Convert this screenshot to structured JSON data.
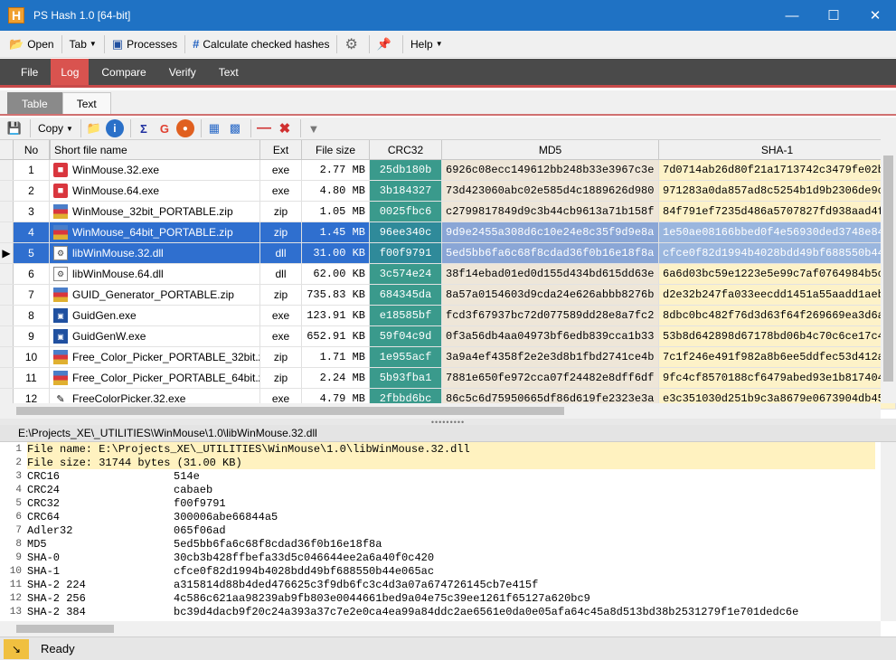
{
  "window": {
    "app_letter": "H",
    "title": "PS Hash 1.0   [64-bit]"
  },
  "toolbar": {
    "open": "Open",
    "tab": "Tab",
    "processes": "Processes",
    "calculate": "Calculate checked hashes",
    "help": "Help"
  },
  "main_tabs": [
    "File",
    "Log",
    "Compare",
    "Verify",
    "Text"
  ],
  "sub_tabs": [
    "Table",
    "Text"
  ],
  "toolbar2": {
    "copy": "Copy"
  },
  "grid": {
    "headers": [
      "No",
      "Short file name",
      "Ext",
      "File size",
      "CRC32",
      "MD5",
      "SHA-1"
    ],
    "rows": [
      {
        "no": "1",
        "name": "WinMouse.32.exe",
        "ext": "exe",
        "size": "2.77  MB",
        "crc32": "25db180b",
        "md5": "6926c08ecc149612bb248b33e3967c3e",
        "sha1": "7d0714ab26d80f21a1713742c3479fe02b"
      },
      {
        "no": "2",
        "name": "WinMouse.64.exe",
        "ext": "exe",
        "size": "4.80  MB",
        "crc32": "3b184327",
        "md5": "73d423060abc02e585d4c1889626d980",
        "sha1": "971283a0da857ad8c5254b1d9b2306de9c"
      },
      {
        "no": "3",
        "name": "WinMouse_32bit_PORTABLE.zip",
        "ext": "zip",
        "size": "1.05  MB",
        "crc32": "0025fbc6",
        "md5": "c2799817849d9c3b44cb9613a71b158f",
        "sha1": "84f791ef7235d486a5707827fd938aad4f"
      },
      {
        "no": "4",
        "name": "WinMouse_64bit_PORTABLE.zip",
        "ext": "zip",
        "size": "1.45  MB",
        "crc32": "96ee340c",
        "md5": "9d9e2455a308d6c10e24e8c35f9d9e8a",
        "sha1": "1e50ae08166bbed0f4e56930ded3748e84"
      },
      {
        "no": "5",
        "name": "libWinMouse.32.dll",
        "ext": "dll",
        "size": "31.00  KB",
        "crc32": "f00f9791",
        "md5": "5ed5bb6fa6c68f8cdad36f0b16e18f8a",
        "sha1": "cfce0f82d1994b4028bdd49bf688550b44"
      },
      {
        "no": "6",
        "name": "libWinMouse.64.dll",
        "ext": "dll",
        "size": "62.00  KB",
        "crc32": "3c574e24",
        "md5": "38f14ebad01ed0d155d434bd615dd63e",
        "sha1": "6a6d03bc59e1223e5e99c7af0764984b5c"
      },
      {
        "no": "7",
        "name": "GUID_Generator_PORTABLE.zip",
        "ext": "zip",
        "size": "735.83  KB",
        "crc32": "684345da",
        "md5": "8a57a0154603d9cda24e626abbb8276b",
        "sha1": "d2e32b247fa033eecdd1451a55aadd1aeb"
      },
      {
        "no": "8",
        "name": "GuidGen.exe",
        "ext": "exe",
        "size": "123.91  KB",
        "crc32": "e18585bf",
        "md5": "fcd3f67937bc72d077589dd28e8a7fc2",
        "sha1": "8dbc0bc482f76d3d63f64f269669ea3d6a"
      },
      {
        "no": "9",
        "name": "GuidGenW.exe",
        "ext": "exe",
        "size": "652.91  KB",
        "crc32": "59f04c9d",
        "md5": "0f3a56db4aa04973bf6edb839cca1b33",
        "sha1": "53b8d642898d67178bd06b4c70c6ce17c4"
      },
      {
        "no": "10",
        "name": "Free_Color_Picker_PORTABLE_32bit.zip",
        "ext": "zip",
        "size": "1.71  MB",
        "crc32": "1e955acf",
        "md5": "3a9a4ef4358f2e2e3d8b1fbd2741ce4b",
        "sha1": "7c1f246e491f982a8b6ee5ddfec53d412a"
      },
      {
        "no": "11",
        "name": "Free_Color_Picker_PORTABLE_64bit.zip",
        "ext": "zip",
        "size": "2.24  MB",
        "crc32": "5b93fba1",
        "md5": "7881e650fe972cca07f24482e8dff6df",
        "sha1": "9fc4cf8570188cf6479abed93e1b817404"
      },
      {
        "no": "12",
        "name": "FreeColorPicker.32.exe",
        "ext": "exe",
        "size": "4.79  MB",
        "crc32": "2fbbd6bc",
        "md5": "86c5c6d75950665df86d619fe2323e3a",
        "sha1": "e3c351030d251b9c3a8679e0673904db45"
      }
    ]
  },
  "path": "E:\\Projects_XE\\_UTILITIES\\WinMouse\\1.0\\libWinMouse.32.dll",
  "log": [
    {
      "n": "1",
      "k": "File name: ",
      "v": "E:\\Projects_XE\\_UTILITIES\\WinMouse\\1.0\\libWinMouse.32.dll"
    },
    {
      "n": "2",
      "k": "File size: ",
      "v": "31744 bytes (31.00 KB)"
    },
    {
      "n": "3",
      "k": "CRC16",
      "v": "514e"
    },
    {
      "n": "4",
      "k": "CRC24",
      "v": "cabaeb"
    },
    {
      "n": "5",
      "k": "CRC32",
      "v": "f00f9791"
    },
    {
      "n": "6",
      "k": "CRC64",
      "v": "300006abe66844a5"
    },
    {
      "n": "7",
      "k": "Adler32",
      "v": "065f06ad"
    },
    {
      "n": "8",
      "k": "MD5",
      "v": "5ed5bb6fa6c68f8cdad36f0b16e18f8a"
    },
    {
      "n": "9",
      "k": "SHA-0",
      "v": "30cb3b428ffbefa33d5c046644ee2a6a40f0c420"
    },
    {
      "n": "10",
      "k": "SHA-1",
      "v": "cfce0f82d1994b4028bdd49bf688550b44e065ac"
    },
    {
      "n": "11",
      "k": "SHA-2 224",
      "v": "a315814d88b4ded476625c3f9db6fc3c4d3a07a674726145cb7e415f"
    },
    {
      "n": "12",
      "k": "SHA-2 256",
      "v": "4c586c621aa98239ab9fb803e0044661bed9a04e75c39ee1261f65127a620bc9"
    },
    {
      "n": "13",
      "k": "SHA-2 384",
      "v": "bc39d4dacb9f20c24a393a37c7e2e0ca4ea99a84ddc2ae6561e0da0e05afa64c45a8d513bd38b2531279f1e701dedc6e"
    }
  ],
  "status": {
    "text": "Ready"
  }
}
